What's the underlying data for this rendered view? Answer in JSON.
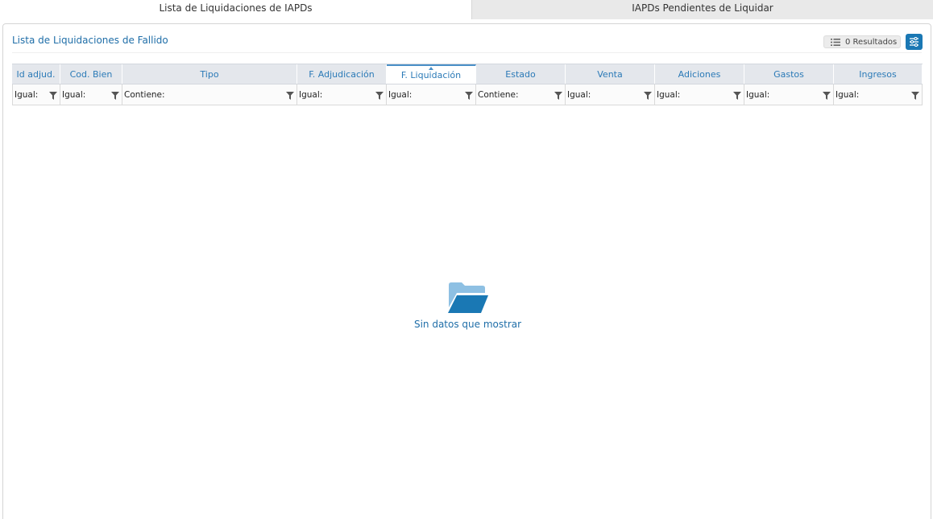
{
  "tabs": [
    {
      "label": "Lista de Liquidaciones de IAPDs",
      "active": true
    },
    {
      "label": "IAPDs Pendientes de Liquidar",
      "active": false
    }
  ],
  "panel": {
    "title": "Lista de Liquidaciones de Fallido",
    "results_label": "0 Resultados"
  },
  "grid": {
    "columns": [
      {
        "header": "Id adjud.",
        "filter": "Igual:"
      },
      {
        "header": "Cod. Bien",
        "filter": "Igual:"
      },
      {
        "header": "Tipo",
        "filter": "Contiene:"
      },
      {
        "header": "F. Adjudicación",
        "filter": "Igual:"
      },
      {
        "header": "F. Liquidación",
        "filter": "Igual:",
        "sorted": "asc"
      },
      {
        "header": "Estado",
        "filter": "Contiene:"
      },
      {
        "header": "Venta",
        "filter": "Igual:"
      },
      {
        "header": "Adiciones",
        "filter": "Igual:"
      },
      {
        "header": "Gastos",
        "filter": "Igual:"
      },
      {
        "header": "Ingresos",
        "filter": "Igual:"
      }
    ]
  },
  "empty_state": {
    "text": "Sin datos que mostrar",
    "icon": "folder-open-icon"
  },
  "colors": {
    "accent": "#1a78b4",
    "header_text": "#2b7ab7",
    "header_bg": "#e4e7ec",
    "inactive_tab_bg": "#e9e9e9"
  }
}
